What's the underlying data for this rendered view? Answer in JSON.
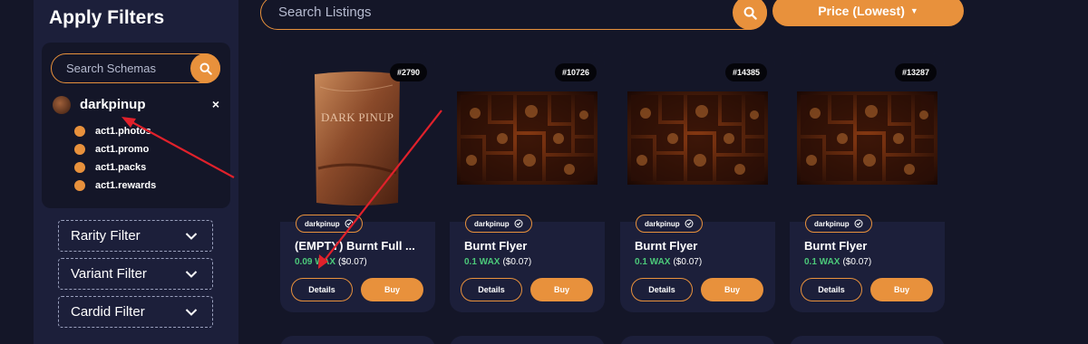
{
  "sidebar": {
    "title": "Apply Filters",
    "schema_search_placeholder": "Search Schemas",
    "collection": {
      "name": "darkpinup",
      "close": "×"
    },
    "schemas": [
      {
        "label": "act1.photos"
      },
      {
        "label": "act1.promo"
      },
      {
        "label": "act1.packs"
      },
      {
        "label": "act1.rewards"
      }
    ],
    "filters": [
      {
        "label": "Rarity Filter"
      },
      {
        "label": "Variant Filter"
      },
      {
        "label": "Cardid Filter"
      }
    ]
  },
  "topbar": {
    "search_placeholder": "Search Listings",
    "sort_label": "Price (Lowest)"
  },
  "cards": [
    {
      "id": "#2790",
      "collection": "darkpinup",
      "name": "(EMPTY) Burnt Full ...",
      "price_wax": "0.09 WAX",
      "price_usd": "($0.07)",
      "details_label": "Details",
      "buy_label": "Buy",
      "image": "pack",
      "pack_text": "DARK PINUP"
    },
    {
      "id": "#10726",
      "collection": "darkpinup",
      "name": "Burnt Flyer",
      "price_wax": "0.1 WAX",
      "price_usd": "($0.07)",
      "details_label": "Details",
      "buy_label": "Buy",
      "image": "flyer"
    },
    {
      "id": "#14385",
      "collection": "darkpinup",
      "name": "Burnt Flyer",
      "price_wax": "0.1 WAX",
      "price_usd": "($0.07)",
      "details_label": "Details",
      "buy_label": "Buy",
      "image": "flyer"
    },
    {
      "id": "#13287",
      "collection": "darkpinup",
      "name": "Burnt Flyer",
      "price_wax": "0.1 WAX",
      "price_usd": "($0.07)",
      "details_label": "Details",
      "buy_label": "Buy",
      "image": "flyer"
    }
  ],
  "colors": {
    "accent": "#e8913c",
    "background": "#141628",
    "panel": "#1c1f3a",
    "price_green": "#4cc97a",
    "annotation_arrow": "#e0212b"
  },
  "icons": {
    "search": "search-icon",
    "close": "close-icon",
    "chevron": "chevron-down-icon",
    "verified": "verified-check-icon",
    "caret": "caret-down-icon"
  }
}
